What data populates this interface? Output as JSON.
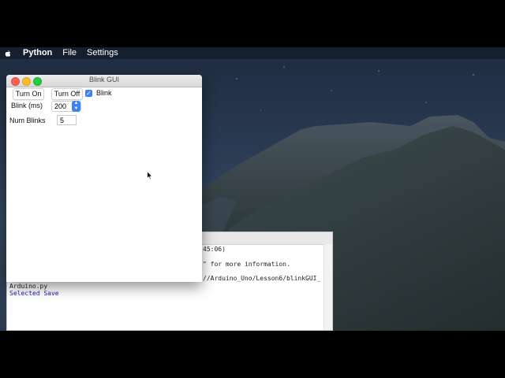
{
  "menubar": {
    "apple_icon": "apple-icon",
    "items": [
      "Python",
      "File",
      "Settings"
    ]
  },
  "console": {
    "lines": [
      "45:06)",
      "\" for more information.",
      "//Arduino_Uno/Lesson6/blinkGUI_",
      "Arduino.py",
      "Selected Save"
    ]
  },
  "gui": {
    "title": "Blink GUI",
    "turn_on": "Turn On",
    "turn_off": "Turn Off",
    "blink_label": "Blink",
    "blink_checked": true,
    "blink_ms_label": "Blink (ms)",
    "blink_ms_value": "200",
    "num_blinks_label": "Num Blinks",
    "num_blinks_value": "5"
  },
  "colors": {
    "accent": "#3b82f6",
    "console_blue_text": "#1b1bb4"
  }
}
